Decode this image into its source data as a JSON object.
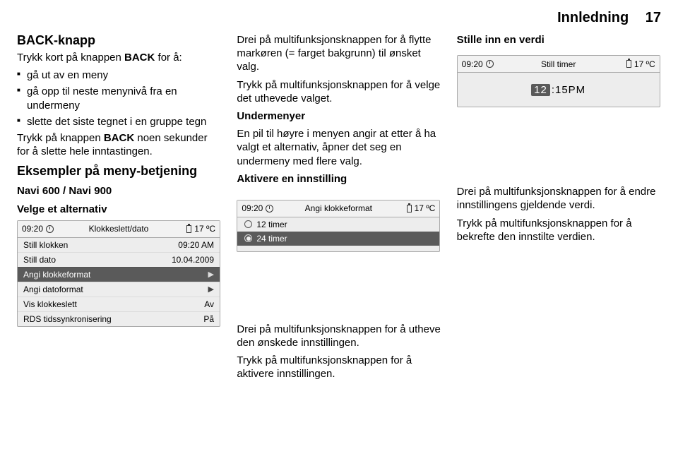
{
  "header": {
    "title": "Innledning",
    "page": "17"
  },
  "col1": {
    "h": "BACK-knapp",
    "p1a": "Trykk kort på knappen ",
    "p1b": "BACK",
    "p1c": " for å:",
    "bullets": [
      "gå ut av en meny",
      "gå opp til neste menynivå fra en undermeny",
      "slette det siste tegnet i en gruppe tegn"
    ],
    "p2a": "Trykk på knappen ",
    "p2b": "BACK",
    "p2c": " noen sekunder for å slette hele inntastingen.",
    "h2": "Eksempler på meny-betjening",
    "sub1": "Navi 600 / Navi 900",
    "sub2": "Velge et alternativ",
    "screen1": {
      "time": "09:20",
      "title": "Klokkeslett/dato",
      "temp": "17 ºC",
      "rows": [
        {
          "l": "Still klokken",
          "r": "09:20 AM"
        },
        {
          "l": "Still dato",
          "r": "10.04.2009"
        },
        {
          "l": "Angi klokkeformat",
          "sel": true,
          "arrow": true
        },
        {
          "l": "Angi datoformat",
          "arrow": true
        },
        {
          "l": "Vis klokkeslett",
          "r": "Av"
        },
        {
          "l": "RDS tidssynkronisering",
          "r": "På"
        }
      ]
    }
  },
  "col2": {
    "p1": "Drei på multifunksjonsknappen for å flytte markøren (= farget bakgrunn) til ønsket valg.",
    "p2": "Trykk på multifunksjonsknappen for å velge det uthevede valget.",
    "h1": "Undermenyer",
    "p3": "En pil til høyre i menyen angir at etter å ha valgt et alternativ, åpner det seg en undermeny med flere valg.",
    "h2": "Aktivere en innstilling",
    "screen2": {
      "time": "09:20",
      "title": "Angi klokkeformat",
      "temp": "17 ºC",
      "opt1": "12 timer",
      "opt2": "24 timer"
    },
    "p4": "Drei på multifunksjonsknappen for å utheve den ønskede innstillingen.",
    "p5": "Trykk på multifunksjonsknappen for å aktivere innstillingen."
  },
  "col3": {
    "h1": "Stille inn en verdi",
    "screen3": {
      "time": "09:20",
      "title": "Still timer",
      "temp": "17 ºC",
      "hh": "12",
      "sep": " : ",
      "mm": "15",
      "ampm": " PM"
    },
    "p1": "Drei på multifunksjonsknappen for å endre innstillingens gjeldende verdi.",
    "p2": "Trykk på multifunksjonsknappen for å bekrefte den innstilte verdien."
  }
}
